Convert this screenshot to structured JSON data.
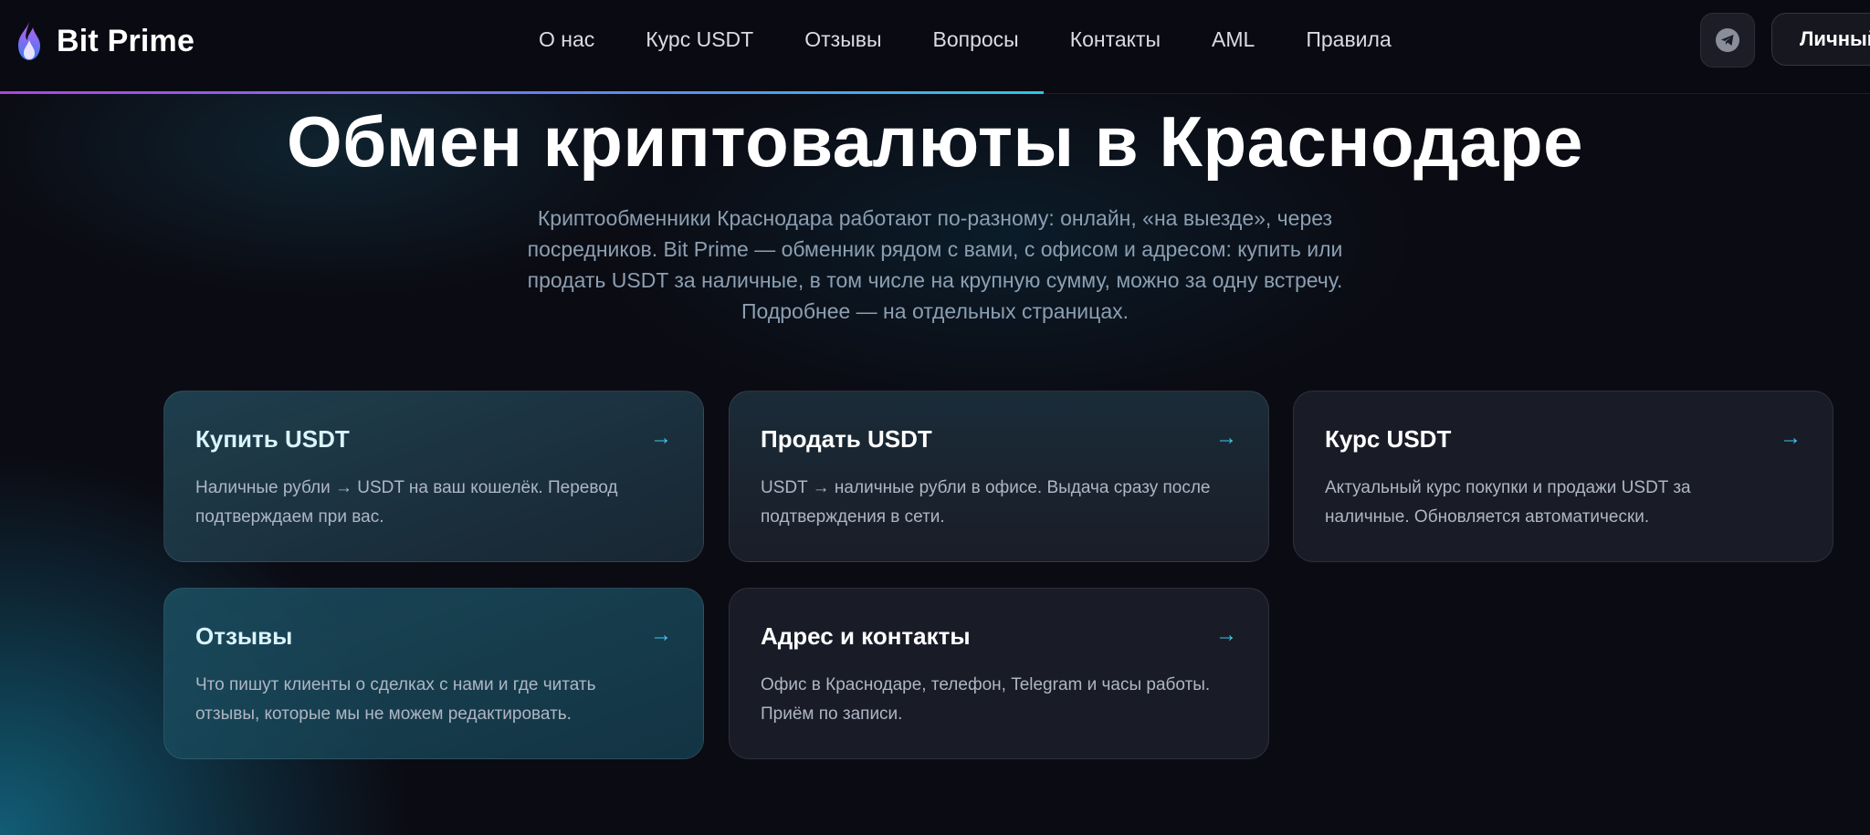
{
  "brand": {
    "name": "Bit Prime"
  },
  "nav": {
    "items": [
      "О нас",
      "Курс USDT",
      "Отзывы",
      "Вопросы",
      "Контакты",
      "AML",
      "Правила"
    ]
  },
  "header": {
    "telegram_icon": "telegram-icon",
    "account_label": "Личный кабинет",
    "progress": 0.558
  },
  "hero": {
    "title": "Обмен криптовалюты в Краснодаре",
    "lead_lines": [
      "Криптообменники Краснодара работают по-разному: онлайн, «на выезде», через",
      "посредников. Bit Prime — обменник рядом с вами, с офисом и адресом: купить или",
      "продать USDT за наличные, в том числе на крупную сумму, можно за одну встречу.",
      "Подробнее — на отдельных страницах."
    ]
  },
  "cards": [
    {
      "title": "Купить USDT",
      "arrow": "→",
      "desc_lines": [
        "Наличные рубли → USDT на ваш кошелёк. Перевод",
        "подтверждаем при вас."
      ]
    },
    {
      "title": "Продать USDT",
      "arrow": "→",
      "desc_lines": [
        "USDT → наличные рубли в офисе. Выдача сразу после",
        "подтверждения в сети."
      ]
    },
    {
      "title": "Курс USDT",
      "arrow": "→",
      "desc_lines": [
        "Актуальный курс покупки и продажи USDT за",
        "наличные. Обновляется автоматически."
      ]
    },
    {
      "title": "Отзывы",
      "arrow": "→",
      "desc_lines": [
        "Что пишут клиенты о сделках с нами и где читать",
        "отзывы, которые мы не можем редактировать."
      ]
    },
    {
      "title": "Адрес и контакты",
      "arrow": "→",
      "desc_lines": [
        "Офис в Краснодаре, телефон, Telegram и часы работы.",
        "Приём по записи."
      ]
    }
  ],
  "colors": {
    "accent": "#3fc6ef",
    "background": "#0b0b13",
    "progress_start": "#b044e0",
    "progress_end": "#2fc4e6"
  }
}
